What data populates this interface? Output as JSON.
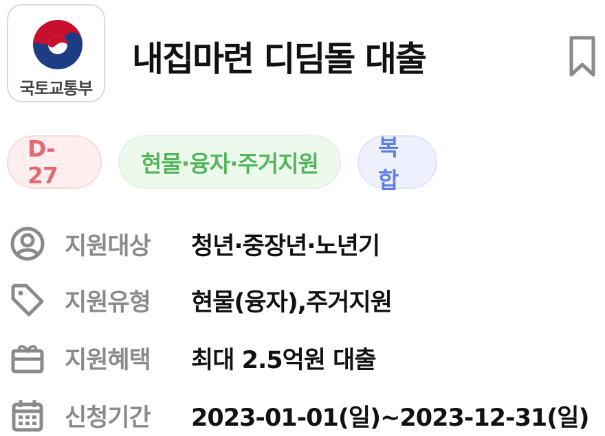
{
  "header": {
    "ministry_name": "국토교통부",
    "title": "내집마련 디딤돌 대출",
    "icons": {
      "logo": "korea-emblem-icon",
      "bookmark": "bookmark-icon"
    }
  },
  "tags": {
    "dday": "D-27",
    "support_type": "현물·융자·주거지원",
    "category": "복합",
    "colors": {
      "dday": "#e46a72",
      "support_type": "#54b55c",
      "category": "#5e7fe6"
    }
  },
  "details": [
    {
      "icon": "person-circle-icon",
      "label": "지원대상",
      "value": "청년·중장년·노년기"
    },
    {
      "icon": "tag-icon",
      "label": "지원유형",
      "value": "현물(융자),주거지원"
    },
    {
      "icon": "gift-icon",
      "label": "지원혜택",
      "value": "최대 2.5억원 대출"
    },
    {
      "icon": "calendar-icon",
      "label": "신청기간",
      "value": "2023-01-01(일)~2023-12-31(일)"
    }
  ]
}
